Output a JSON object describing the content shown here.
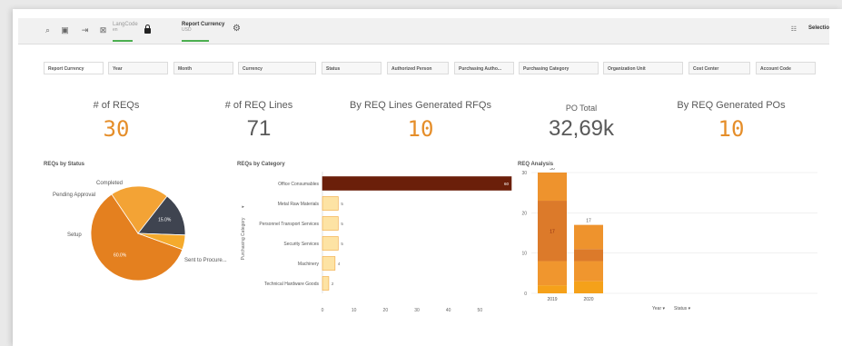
{
  "toolbar": {
    "lang_code_label": "LangCode",
    "lang_code_value": "en",
    "report_currency_label": "Report Currency",
    "report_currency_value": "USD",
    "selections_label": "Selectio"
  },
  "filters": [
    "Report Currency",
    "Year",
    "Month",
    "Currency",
    "Status",
    "Authorized Person",
    "Purchasing Autho...",
    "Purchasing Category",
    "Organization Unit",
    "Cost Center",
    "Account Code"
  ],
  "kpis": [
    {
      "label": "# of REQs",
      "value": "30"
    },
    {
      "label": "# of REQ Lines",
      "value": "71"
    },
    {
      "label": "By REQ Lines Generated RFQs",
      "value": "10"
    },
    {
      "label": "PO Total",
      "value": "32,69k"
    },
    {
      "label": "By REQ Generated POs",
      "value": "10"
    }
  ],
  "chart_data": [
    {
      "type": "pie",
      "title": "REQs by Status",
      "categories": [
        "Sent to Procure...",
        "Setup",
        "Pending Approval",
        "Completed"
      ],
      "values": [
        60,
        20,
        15,
        5
      ],
      "slice_labels": [
        "60.0%",
        "",
        "15.0%",
        ""
      ],
      "colors": [
        "#e4801f",
        "#f3a335",
        "#3f4450",
        "#f5aa2c"
      ]
    },
    {
      "type": "bar",
      "orientation": "horizontal",
      "title": "REQs by Category",
      "ylabel": "Purchasing Category",
      "categories": [
        "Office Consumables",
        "Metal Raw Materials",
        "Personnel Transport Services",
        "Security Services",
        "Machinery",
        "Technical Hardware Goods"
      ],
      "values": [
        60,
        5,
        5,
        5,
        4,
        2
      ],
      "xlim": [
        0,
        60
      ],
      "xticks": [
        "0",
        "10",
        "20",
        "30",
        "40",
        "50"
      ],
      "colors": {
        "top": "#6b1f0a",
        "rest": "#fde3a4",
        "rest_border": "#f0a63a"
      }
    },
    {
      "type": "bar",
      "stacked": true,
      "title": "REQ Analysis",
      "categories": [
        "2019",
        "2020"
      ],
      "yticks": [
        "0",
        "10",
        "20",
        "30"
      ],
      "ylim": [
        0,
        30
      ],
      "totals": [
        30,
        17
      ],
      "series": [
        {
          "values": [
            2,
            3
          ],
          "color": "#f5a11a"
        },
        {
          "values": [
            6,
            5
          ],
          "color": "#f0962e"
        },
        {
          "values": [
            15,
            3
          ],
          "color": "#dc7a2a"
        },
        {
          "values": [
            7,
            6
          ],
          "color": "#ee932d"
        }
      ],
      "segment_labels": [
        "17",
        ""
      ],
      "legend": [
        "Year",
        "Status"
      ]
    }
  ]
}
